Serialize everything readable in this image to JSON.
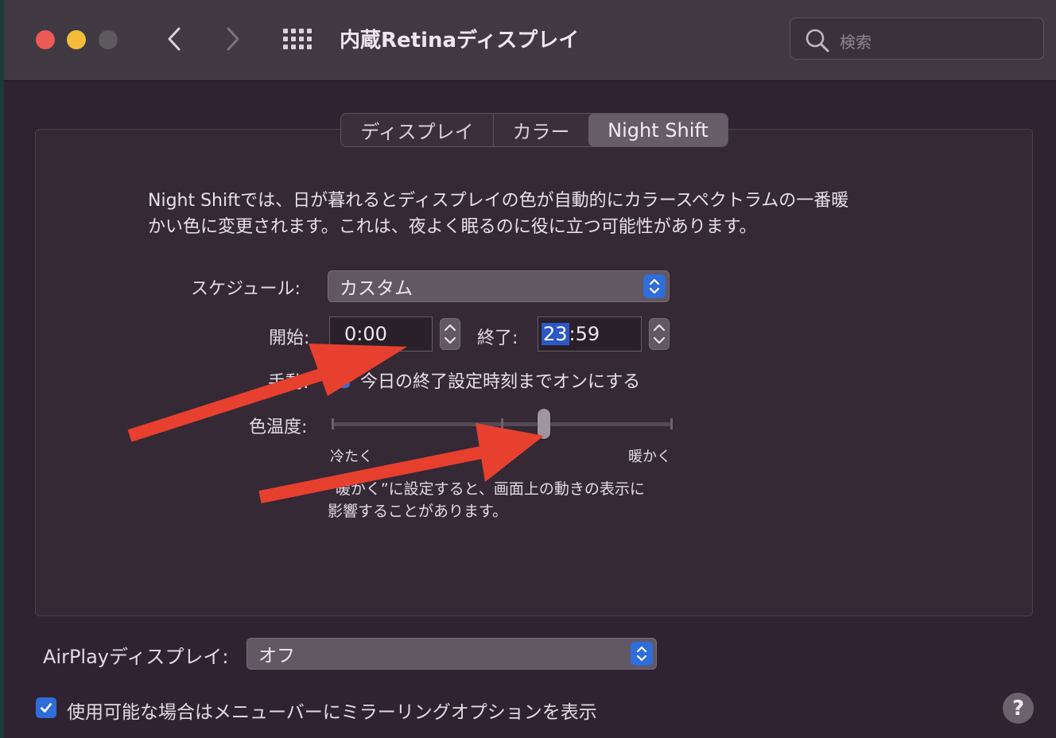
{
  "window": {
    "title": "内蔵Retinaディスプレイ",
    "search_placeholder": "検索"
  },
  "tabs": [
    {
      "label": "ディスプレイ",
      "selected": false
    },
    {
      "label": "カラー",
      "selected": false
    },
    {
      "label": "Night Shift",
      "selected": true
    }
  ],
  "night_shift": {
    "description_line1": "Night Shiftでは、日が暮れるとディスプレイの色が自動的にカラースペクトラムの一番暖",
    "description_line2": "かい色に変更されます。これは、夜よく眠るのに役に立つ可能性があります。",
    "schedule_label": "スケジュール:",
    "schedule_value": "カスタム",
    "start_label": "開始:",
    "start_value": "0:00",
    "end_label": "終了:",
    "end_hour": "23",
    "end_rest": ":59",
    "manual_label": "手動:",
    "manual_text": "今日の終了設定時刻までオンにする",
    "manual_checked": true,
    "temperature_label": "色温度:",
    "temperature_min_label": "冷たく",
    "temperature_max_label": "暖かく",
    "temperature_level": 0.62,
    "warning_line1": "“暖かく”に設定すると、画面上の動きの表示に",
    "warning_line2": "影響することがあります。"
  },
  "airplay": {
    "label": "AirPlayディスプレイ:",
    "value": "オフ"
  },
  "mirroring": {
    "label": "使用可能な場合はメニューバーにミラーリングオプションを表示",
    "checked": true
  },
  "help": {
    "label": "?"
  },
  "colors": {
    "accent": "#2f6dd9",
    "annotation_arrow": "#e8402e",
    "background": "#2f2331"
  }
}
